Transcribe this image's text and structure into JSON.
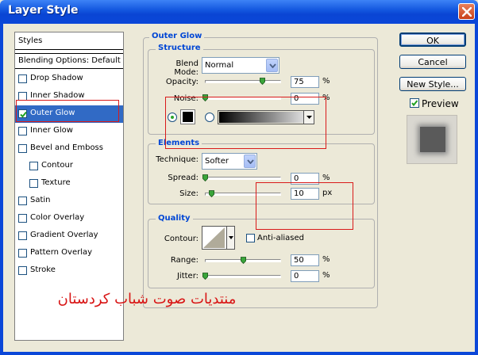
{
  "window": {
    "title": "Layer Style"
  },
  "styles_panel": {
    "header": "Styles",
    "blending_options": "Blending Options: Default",
    "items": [
      {
        "label": "Drop Shadow",
        "checked": false,
        "selected": false,
        "indent": false
      },
      {
        "label": "Inner Shadow",
        "checked": false,
        "selected": false,
        "indent": false
      },
      {
        "label": "Outer Glow",
        "checked": true,
        "selected": true,
        "indent": false
      },
      {
        "label": "Inner Glow",
        "checked": false,
        "selected": false,
        "indent": false
      },
      {
        "label": "Bevel and Emboss",
        "checked": false,
        "selected": false,
        "indent": false
      },
      {
        "label": "Contour",
        "checked": false,
        "selected": false,
        "indent": true
      },
      {
        "label": "Texture",
        "checked": false,
        "selected": false,
        "indent": true
      },
      {
        "label": "Satin",
        "checked": false,
        "selected": false,
        "indent": false
      },
      {
        "label": "Color Overlay",
        "checked": false,
        "selected": false,
        "indent": false
      },
      {
        "label": "Gradient Overlay",
        "checked": false,
        "selected": false,
        "indent": false
      },
      {
        "label": "Pattern Overlay",
        "checked": false,
        "selected": false,
        "indent": false
      },
      {
        "label": "Stroke",
        "checked": false,
        "selected": false,
        "indent": false
      }
    ]
  },
  "outer_glow": {
    "title": "Outer Glow",
    "structure": {
      "title": "Structure",
      "blend_mode_label": "Blend Mode:",
      "blend_mode_value": "Normal",
      "opacity_label": "Opacity:",
      "opacity_value": "75",
      "opacity_unit": "%",
      "opacity_level": 0.75,
      "noise_label": "Noise:",
      "noise_value": "0",
      "noise_unit": "%",
      "noise_level": 0,
      "color_mode": "solid"
    },
    "elements": {
      "title": "Elements",
      "technique_label": "Technique:",
      "technique_value": "Softer",
      "spread_label": "Spread:",
      "spread_value": "0",
      "spread_unit": "%",
      "size_label": "Size:",
      "size_value": "10",
      "size_unit": "px"
    },
    "quality": {
      "title": "Quality",
      "contour_label": "Contour:",
      "anti_aliased_label": "Anti-aliased",
      "anti_aliased_checked": false,
      "range_label": "Range:",
      "range_value": "50",
      "range_unit": "%",
      "range_level": 0.5,
      "jitter_label": "Jitter:",
      "jitter_value": "0",
      "jitter_unit": "%",
      "jitter_level": 0
    }
  },
  "buttons": {
    "ok": "OK",
    "cancel": "Cancel",
    "new_style": "New Style...",
    "preview_label": "Preview",
    "preview_checked": true
  },
  "watermark": "منتديات صوت شباب كردستان",
  "colors": {
    "title_bar": "#0b47d8",
    "selection": "#316ac5",
    "group_title": "#0046d5",
    "annotation_red": "#d91a1a"
  }
}
